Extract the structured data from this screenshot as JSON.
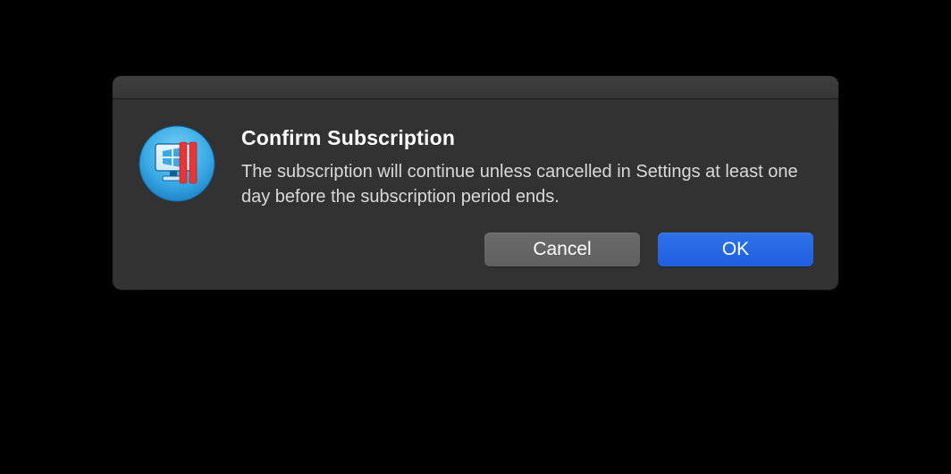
{
  "dialog": {
    "title": "Confirm Subscription",
    "message": "The subscription will continue unless cancelled in Settings at least one day before the subscription period ends.",
    "buttons": {
      "cancel": "Cancel",
      "ok": "OK"
    },
    "icon": {
      "name": "parallels-app-icon",
      "bg_gradient_top": "#5bc4f2",
      "bg_gradient_bottom": "#1c8fd6",
      "accent_color": "#e93535"
    }
  }
}
